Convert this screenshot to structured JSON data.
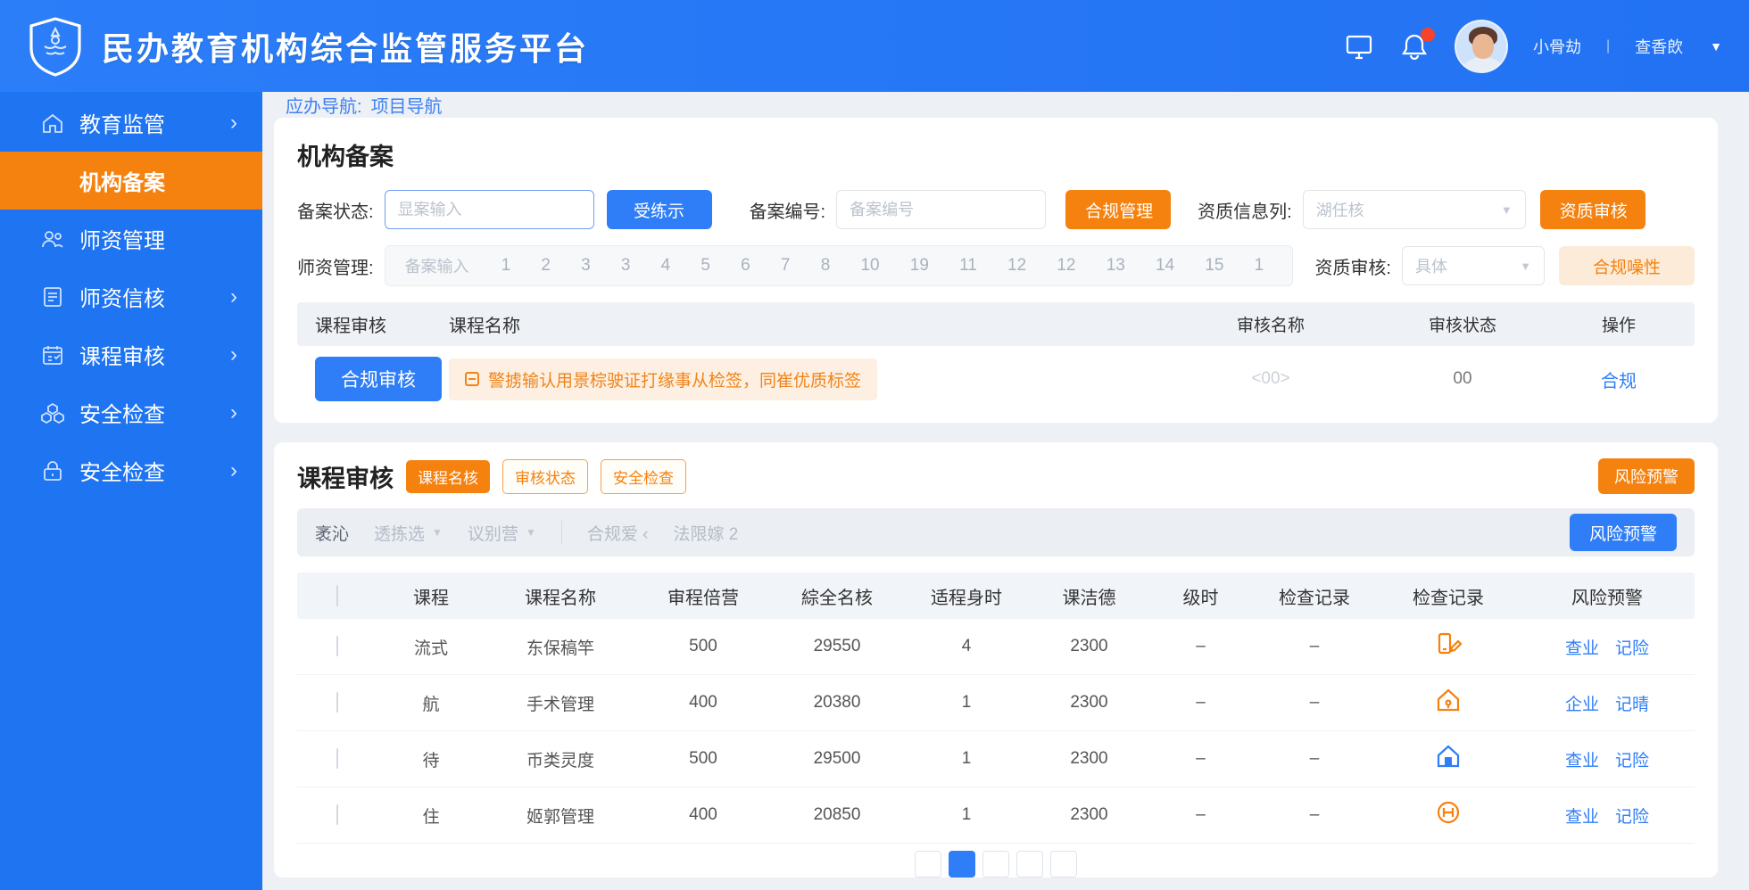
{
  "header": {
    "title": "民办教育机构综合监管服务平台",
    "user_name": "小骨劫",
    "user_sep": "|",
    "user_role": "查香欴",
    "caret": "▼"
  },
  "sidebar": {
    "items": [
      {
        "label": "教育监管",
        "icon": "home-icon",
        "chevron": "›"
      },
      {
        "label": "机构备案",
        "icon": "",
        "chevron": ""
      },
      {
        "label": "师资管理",
        "icon": "people-icon",
        "chevron": ""
      },
      {
        "label": "师资信核",
        "icon": "doc-check-icon",
        "chevron": "›"
      },
      {
        "label": "课程审核",
        "icon": "calendar-icon",
        "chevron": "›"
      },
      {
        "label": "安全检查",
        "icon": "cubes-icon",
        "chevron": "›"
      },
      {
        "label": "安全检查",
        "icon": "lock-icon",
        "chevron": "›"
      }
    ]
  },
  "breadcrumb": {
    "prefix": "应办导航:",
    "current": "项目导航"
  },
  "filing_card": {
    "title": "机构备案",
    "row1": {
      "status_label": "备案状态:",
      "status_placeholder": "显案输入",
      "search_button": "受练示",
      "number_label": "备案编号:",
      "number_placeholder": "备案编号",
      "compliance_button": "合规管理",
      "qualification_label": "资质信息列:",
      "qualification_placeholder": "湖任核",
      "audit_button": "资质审核"
    },
    "row2": {
      "teacher_label": "师资管理:",
      "field_placeholder": "备案输入",
      "numbers": [
        "1",
        "2",
        "3",
        "3",
        "4",
        "5",
        "6",
        "7",
        "8",
        "10",
        "19",
        "11",
        "12",
        "12",
        "13",
        "14",
        "15",
        "1"
      ],
      "audit_label": "资质审核:",
      "audit_placeholder": "具体",
      "compliance_attr_button": "合规噪性"
    },
    "mini_table": {
      "headers": [
        "课程审核",
        "课程名称",
        "审核名称",
        "审核状态",
        "操作"
      ],
      "row": {
        "button": "合规审核",
        "warning": "警掳输认用景棕驶证打缘事从检签，同崔优质标签",
        "audit_name": "<00>",
        "audit_status": "00",
        "action": "合规"
      }
    }
  },
  "course_card": {
    "title": "课程审核",
    "tags": [
      {
        "label": "课程名核"
      },
      {
        "label": "审核状态"
      },
      {
        "label": "安全检查"
      }
    ],
    "risk_button_top": "风险预警",
    "filter": {
      "label": "袤沁",
      "dropdown1": "透拣选",
      "dropdown2": "议别营",
      "item3": "合规爱 ‹",
      "item4": "法限嫁 2",
      "risk_button": "风险预警"
    },
    "table": {
      "headers": [
        "课程",
        "课程名称",
        "审程倍营",
        "綜全名核",
        "适程身时",
        "课洁德",
        "级时",
        "检查记录",
        "检查记录",
        "风险预警"
      ],
      "rows": [
        {
          "course": "流式",
          "name": "东保稿竿",
          "c3": "500",
          "c4": "29550",
          "c5": "4",
          "c6": "2300",
          "c7": "–",
          "c8": "–",
          "icon": "device-edit-icon",
          "link1": "查业",
          "link2": "记险"
        },
        {
          "course": "航",
          "name": "手术管理",
          "c3": "400",
          "c4": "20380",
          "c5": "1",
          "c6": "2300",
          "c7": "–",
          "c8": "–",
          "icon": "home-outline-icon",
          "link1": "企业",
          "link2": "记晴"
        },
        {
          "course": "待",
          "name": "币类灵度",
          "c3": "500",
          "c4": "29500",
          "c5": "1",
          "c6": "2300",
          "c7": "–",
          "c8": "–",
          "icon": "home-filled-icon",
          "link1": "查业",
          "link2": "记险"
        },
        {
          "course": "住",
          "name": "姬郭管理",
          "c3": "400",
          "c4": "20850",
          "c5": "1",
          "c6": "2300",
          "c7": "–",
          "c8": "–",
          "icon": "circle-h-icon",
          "link1": "查业",
          "link2": "记险"
        }
      ]
    }
  },
  "colors": {
    "accent_blue": "#2f7ef7",
    "accent_orange": "#f5810e",
    "sidebar_blue": "#1e74f1",
    "active_orange": "#f5820f",
    "notification_red": "#f5432c",
    "link_blue": "#2f7ef7"
  }
}
